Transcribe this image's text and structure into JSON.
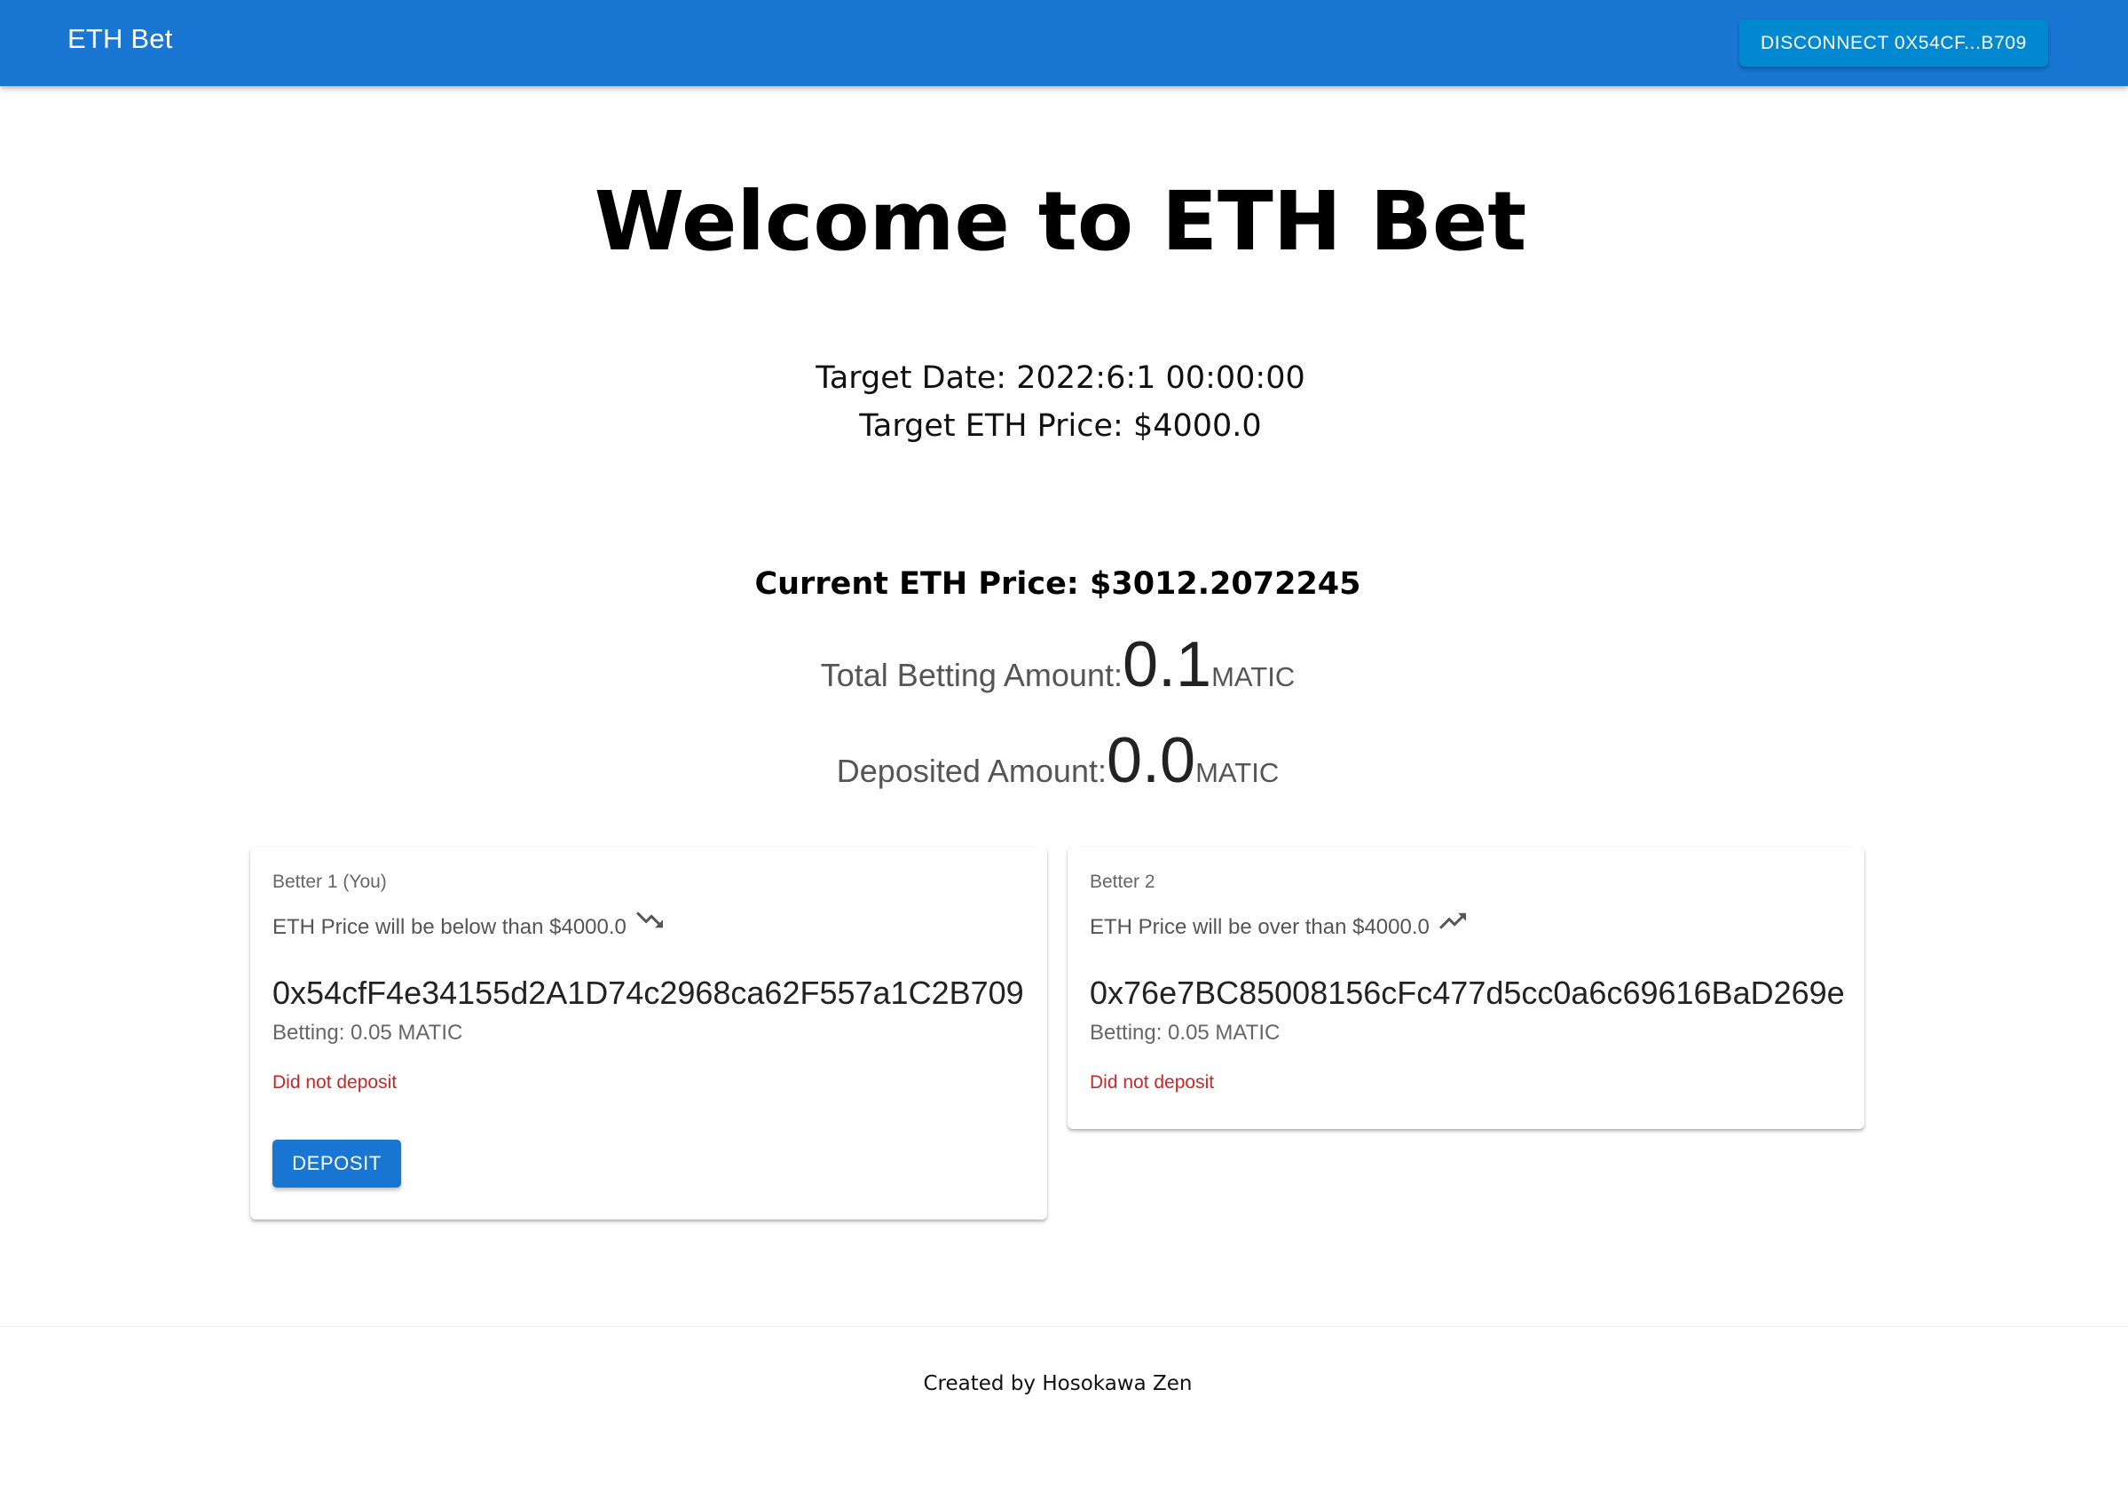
{
  "header": {
    "title": "ETH Bet",
    "disconnect_label": "DISCONNECT 0X54CF...B709"
  },
  "main": {
    "title": "Welcome to ETH Bet",
    "target_date": "Target Date: 2022:6:1 00:00:00",
    "target_price": "Target ETH Price: $4000.0",
    "current_price": "Current ETH Price: $3012.2072245",
    "total_betting": {
      "label": "Total Betting Amount:",
      "value": "0.1",
      "unit": "MATIC"
    },
    "deposited": {
      "label": "Deposited Amount:",
      "value": "0.0",
      "unit": "MATIC"
    }
  },
  "betters": [
    {
      "heading": "Better 1 (You)",
      "prediction": "ETH Price will be below than $4000.0",
      "trend_icon": "trending-down-icon",
      "address": "0x54cfF4e34155d2A1D74c2968ca62F557a1C2B709",
      "betting": "Betting: 0.05 MATIC",
      "status": "Did not deposit",
      "deposit_label": "DEPOSIT"
    },
    {
      "heading": "Better 2",
      "prediction": "ETH Price will be over than $4000.0",
      "trend_icon": "trending-up-icon",
      "address": "0x76e7BC85008156cFc477d5cc0a6c69616BaD269e",
      "betting": "Betting: 0.05 MATIC",
      "status": "Did not deposit"
    }
  ],
  "footer": {
    "text": "Created by Hosokawa Zen"
  },
  "colors": {
    "appbar": "#1976d2",
    "disconnect_button": "#0288d1",
    "deposit_button": "#1976d2",
    "status_error": "#c62828"
  }
}
